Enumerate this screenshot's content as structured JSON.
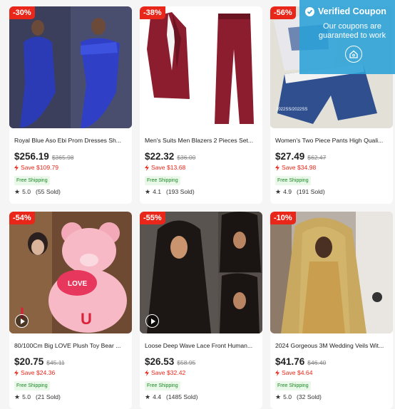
{
  "products": [
    {
      "discount": "-30%",
      "title": "Royal Blue Aso Ebi Prom Dresses Sh...",
      "price": "$256.19",
      "original_price": "$365.98",
      "save": "Save $109.79",
      "shipping": "Free Shipping",
      "rating": "5.0",
      "sold": "(55 Sold)",
      "has_video": false
    },
    {
      "discount": "-38%",
      "title": "Men's Suits Men Blazers 2 Pieces Set...",
      "price": "$22.32",
      "original_price": "$36.00",
      "save": "Save $13.68",
      "shipping": "Free Shipping",
      "rating": "4.1",
      "sold": "(193 Sold)",
      "has_video": false
    },
    {
      "discount": "-56%",
      "title": "Women's Two Piece Pants High Quali...",
      "price": "$27.49",
      "original_price": "$62.47",
      "save": "Save $34.98",
      "shipping": "Free Shipping",
      "rating": "4.9",
      "sold": "(191 Sold)",
      "has_video": false
    },
    {
      "discount": "-54%",
      "title": "80/100Cm Big LOVE Plush Toy Bear ...",
      "price": "$20.75",
      "original_price": "$45.11",
      "save": "Save $24.36",
      "shipping": "Free Shipping",
      "rating": "5.0",
      "sold": "(21 Sold)",
      "has_video": true
    },
    {
      "discount": "-55%",
      "title": "Loose Deep Wave Lace Front Human...",
      "price": "$26.53",
      "original_price": "$58.95",
      "save": "Save $32.42",
      "shipping": "Free Shipping",
      "rating": "4.4",
      "sold": "(1485 Sold)",
      "has_video": true
    },
    {
      "discount": "-10%",
      "title": "2024 Gorgeous 3M Wedding Veils Wit...",
      "price": "$41.76",
      "original_price": "$46.40",
      "save": "Save $4.64",
      "shipping": "Free Shipping",
      "rating": "5.0",
      "sold": "(32 Sold)",
      "has_video": false
    }
  ],
  "coupon": {
    "title": "Verified Coupon",
    "text": "Our coupons are guaranteed to work"
  },
  "colors": {
    "discount_badge": "#e8271a",
    "save_text": "#e8271a",
    "shipping_bg": "#eaf8ea",
    "shipping_text": "#1c8a26",
    "coupon_bg": "#29a0d7"
  }
}
